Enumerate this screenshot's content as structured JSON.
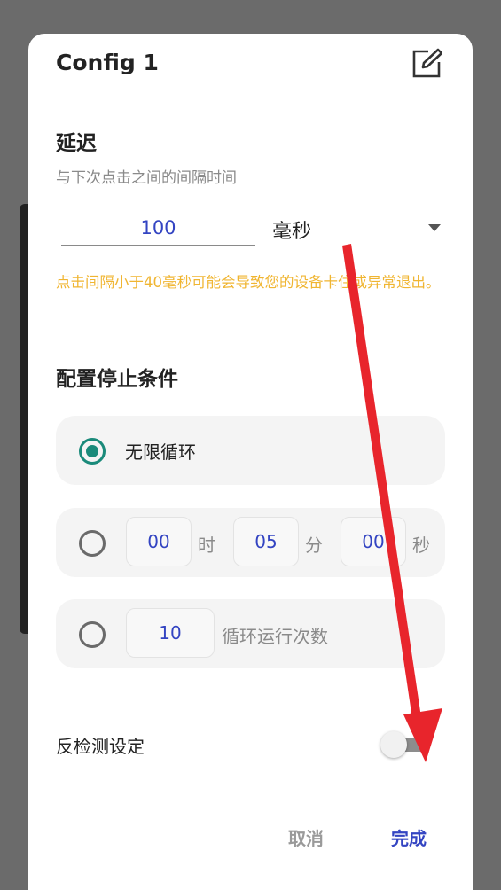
{
  "dialog": {
    "title": "Config 1",
    "edit_icon": "edit-icon"
  },
  "delay": {
    "heading": "延迟",
    "subtitle": "与下次点击之间的间隔时间",
    "value": "100",
    "unit": "毫秒",
    "warning": "点击间隔小于40毫秒可能会导致您的设备卡住或异常退出。"
  },
  "stop_conditions": {
    "heading": "配置停止条件",
    "options": [
      {
        "label": "无限循环",
        "selected": true
      },
      {
        "hours": "00",
        "hours_unit": "时",
        "minutes": "05",
        "minutes_unit": "分",
        "seconds": "00",
        "seconds_unit": "秒",
        "selected": false
      },
      {
        "count": "10",
        "count_label": "循环运行次数",
        "selected": false
      }
    ]
  },
  "anti_detection": {
    "label": "反检测设定",
    "enabled": false
  },
  "footer": {
    "cancel_label": "取消",
    "done_label": "完成"
  },
  "colors": {
    "accent": "#3344c2",
    "radio_checked": "#1a8a7a",
    "warning": "#f0b531",
    "annotation_arrow": "#e8252c"
  }
}
